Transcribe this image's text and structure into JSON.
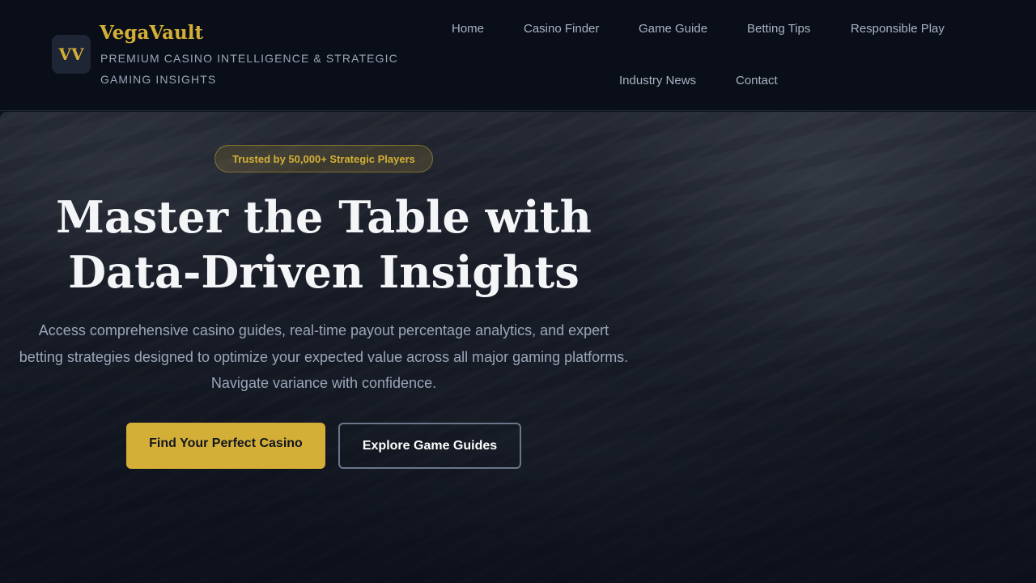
{
  "brand": {
    "logo_text": "VV",
    "name": "VegaVault",
    "tagline": "Premium Casino Intelligence & Strategic Gaming Insights"
  },
  "nav": {
    "items": [
      {
        "label": "Home"
      },
      {
        "label": "Casino Finder"
      },
      {
        "label": "Game Guide"
      },
      {
        "label": "Betting Tips"
      },
      {
        "label": "Responsible Play"
      },
      {
        "label": "Industry News"
      },
      {
        "label": "Contact"
      }
    ]
  },
  "hero": {
    "badge": "Trusted by 50,000+ Strategic Players",
    "title_line1": "Master the Table with",
    "title_line2": "Data-Driven Insights",
    "description": "Access comprehensive casino guides, real-time payout percentage analytics, and expert betting strategies designed to optimize your expected value across all major gaming platforms. Navigate variance with confidence.",
    "primary_cta": "Find Your Perfect Casino",
    "secondary_cta": "Explore Game Guides"
  },
  "colors": {
    "accent": "#d4af37",
    "background": "#0b0f19",
    "nav_text": "#a8b3c4",
    "muted_text": "#9aa6b8"
  }
}
